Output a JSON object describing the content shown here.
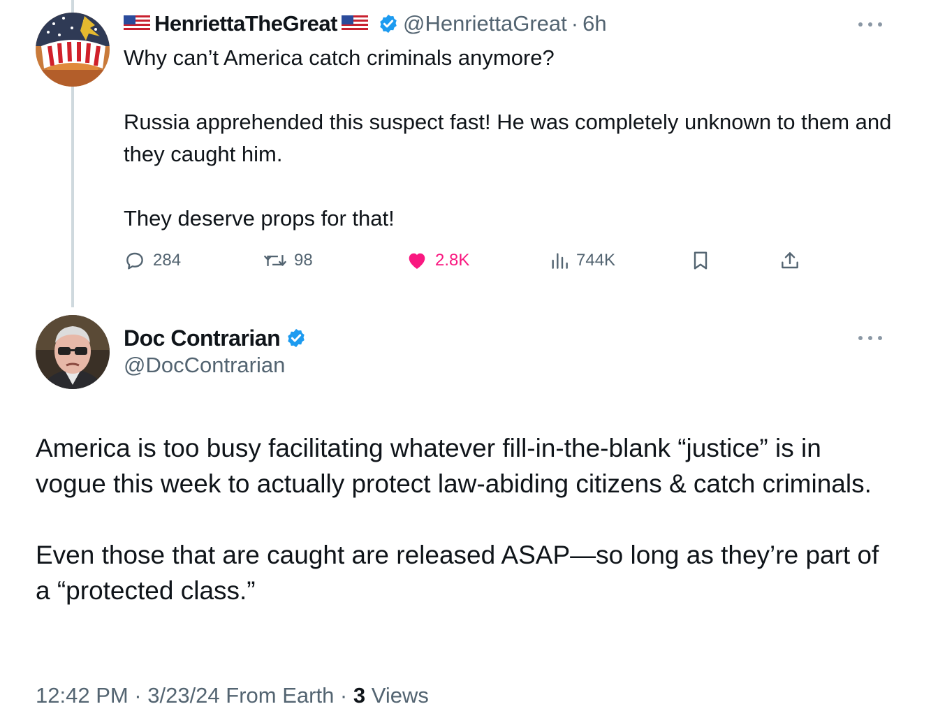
{
  "tweet1": {
    "display_name": "HenriettaTheGreat",
    "handle": "@HenriettaGreat",
    "separator": "·",
    "time": "6h",
    "text_line1": "Why can’t America catch criminals anymore?",
    "text_para2": "Russia apprehended this suspect fast! He was completely unknown to them and they caught him.",
    "text_para3": "They deserve props for that!",
    "stats": {
      "replies": "284",
      "reposts": "98",
      "likes": "2.8K",
      "views": "744K"
    }
  },
  "tweet2": {
    "display_name": "Doc Contrarian",
    "handle": "@DocContrarian",
    "text_para1": "America is too busy facilitating whatever fill-in-the-blank “justice” is in vogue this week to actually protect law-abiding citizens & catch criminals.",
    "text_para2": "Even those that are caught are released ASAP—so long as they’re part of a “protected class.”",
    "timestamp": "12:42 PM · 3/23/24 From Earth ·",
    "views_count": "3",
    "views_label": "Views"
  },
  "colors": {
    "text": "#0f1419",
    "secondary": "#536471",
    "verified": "#1d9bf0",
    "like": "#f91880",
    "thread_line": "#cfd9de"
  },
  "icons": [
    "flag-us-icon",
    "verified-badge-icon",
    "more-icon",
    "reply-icon",
    "repost-icon",
    "heart-icon",
    "views-icon",
    "bookmark-icon",
    "share-icon"
  ]
}
